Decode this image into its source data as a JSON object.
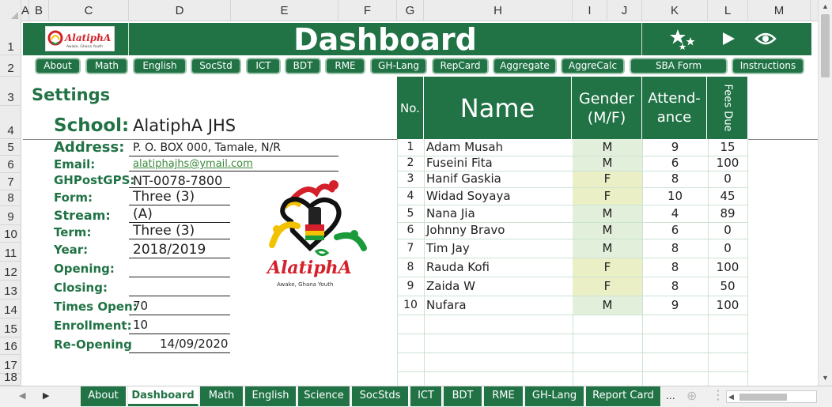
{
  "columns": [
    "A",
    "B",
    "C",
    "D",
    "E",
    "F",
    "G",
    "H",
    "I",
    "J",
    "K",
    "L",
    "M"
  ],
  "rows": [
    "1",
    "2",
    "3",
    "4",
    "5",
    "6",
    "7",
    "8",
    "9",
    "10",
    "11",
    "12",
    "13",
    "14",
    "15",
    "16",
    "17",
    "18"
  ],
  "banner": {
    "title": "Dashboard",
    "logo_text": "AlatiphA",
    "logo_subtext": "Awake, Ghana Youth",
    "icons": [
      "stars-icon",
      "play-icon",
      "eye-icon"
    ]
  },
  "nav_buttons": [
    "About",
    "Math",
    "English",
    "SocStd",
    "ICT",
    "BDT",
    "RME",
    "GH-Lang",
    "RepCard",
    "Aggregate",
    "AggreCalc",
    "SBA Form",
    "Instructions"
  ],
  "settings": {
    "heading": "Settings",
    "school_label": "School:",
    "school_value": "AlatiphA JHS",
    "fields": [
      {
        "label": "Address:",
        "value": "P. O. BOX 000, Tamale, N/R"
      },
      {
        "label": "Email:",
        "value": "alatiphajhs@ymail.com"
      },
      {
        "label": "GHPostGPS:",
        "value": "NT-0078-7800"
      },
      {
        "label": "Form:",
        "value": "Three (3)"
      },
      {
        "label": "Stream:",
        "value": "(A)"
      },
      {
        "label": "Term:",
        "value": "Three (3)"
      },
      {
        "label": "Year:",
        "value": "2018/2019"
      },
      {
        "label": "Opening:",
        "value": ""
      },
      {
        "label": "Closing:",
        "value": ""
      },
      {
        "label": "Times Open:",
        "value": "70"
      },
      {
        "label": "Enrollment:",
        "value": "10"
      },
      {
        "label": "Re-Opening",
        "value": "14/09/2020"
      }
    ],
    "logo_text": "AlatiphA",
    "logo_subtext": "Awake, Ghana Youth"
  },
  "table": {
    "headers": {
      "no": "No.",
      "name": "Name",
      "gender_1": "Gender",
      "gender_2": "(M/F)",
      "attendance_1": "Attend-",
      "attendance_2": "ance",
      "fees": "Fees Due"
    },
    "rows": [
      {
        "no": "1",
        "name": "Adam Musah",
        "gender": "M",
        "attendance": "9",
        "fees": "15"
      },
      {
        "no": "2",
        "name": "Fuseini Fita",
        "gender": "M",
        "attendance": "6",
        "fees": "100"
      },
      {
        "no": "3",
        "name": "Hanif Gaskia",
        "gender": "F",
        "attendance": "8",
        "fees": "0"
      },
      {
        "no": "4",
        "name": "Widad Soyaya",
        "gender": "F",
        "attendance": "10",
        "fees": "45"
      },
      {
        "no": "5",
        "name": "Nana Jia",
        "gender": "M",
        "attendance": "4",
        "fees": "89"
      },
      {
        "no": "6",
        "name": "Johnny Bravo",
        "gender": "M",
        "attendance": "6",
        "fees": "0"
      },
      {
        "no": "7",
        "name": "Tim Jay",
        "gender": "M",
        "attendance": "8",
        "fees": "0"
      },
      {
        "no": "8",
        "name": "Rauda Kofi",
        "gender": "F",
        "attendance": "8",
        "fees": "100"
      },
      {
        "no": "9",
        "name": "Zaida W",
        "gender": "F",
        "attendance": "8",
        "fees": "50"
      },
      {
        "no": "10",
        "name": "Nufara",
        "gender": "M",
        "attendance": "9",
        "fees": "100"
      }
    ]
  },
  "sheet_tabs": [
    "About",
    "Dashboard",
    "Math",
    "English",
    "Science",
    "SocStds",
    "ICT",
    "BDT",
    "RME",
    "GH-Lang",
    "Report Card"
  ],
  "active_tab": "Dashboard",
  "tab_overflow": "...",
  "colors": {
    "brand_green": "#217346",
    "male_fill": "#e2efda",
    "female_fill": "#ebefc6"
  }
}
